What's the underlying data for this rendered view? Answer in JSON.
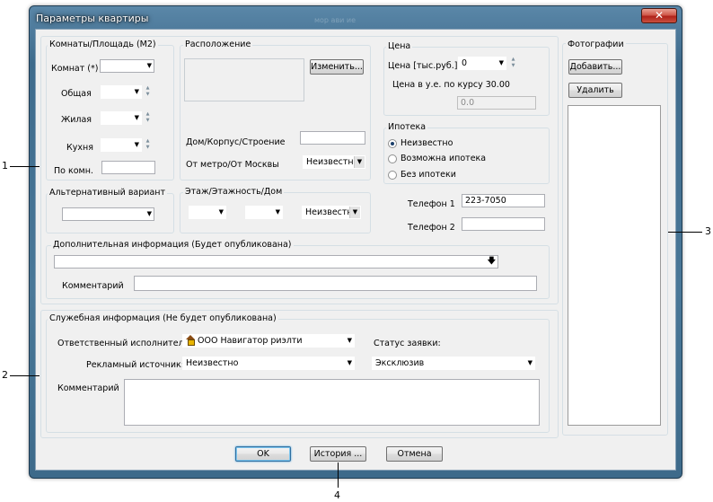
{
  "window": {
    "title": "Параметры квартиры",
    "ghost_title": "мор ави ие",
    "close_glyph": "✕"
  },
  "rooms": {
    "title": "Комнаты/Площадь (М2)",
    "rooms_label": "Комнат (*)",
    "rooms_value": "",
    "total_label": "Общая",
    "living_label": "Жилая",
    "kitchen_label": "Кухня",
    "per_room_label": "По комн."
  },
  "alt": {
    "title": "Альтернативный вариант",
    "value": ""
  },
  "location": {
    "title": "Расположение",
    "change_button": "Изменить...",
    "house_label": "Дом/Корпус/Строение",
    "metro_label": "От метро/От Москвы",
    "metro_value": "Неизвестно"
  },
  "floor": {
    "title": "Этаж/Этажность/Дом",
    "house_type_value": "Неизвестно"
  },
  "price": {
    "title": "Цена",
    "price_label": "Цена [тыс.руб.]",
    "price_value": "0",
    "rate_label": "Цена в у.е. по курсу 30.00",
    "usd_value": "0.0"
  },
  "mortgage": {
    "title": "Ипотека",
    "options": [
      "Неизвестно",
      "Возможна ипотека",
      "Без ипотеки"
    ],
    "selected": 0
  },
  "phones": {
    "phone1_label": "Телефон 1",
    "phone1_value": "223-7050",
    "phone2_label": "Телефон 2",
    "phone2_value": ""
  },
  "extra": {
    "title": "Дополнительная информация (Будет опубликована)",
    "comment_label": "Комментарий"
  },
  "service": {
    "title": "Служебная информация (Не будет опубликована)",
    "responsible_label": "Ответственный исполнитель:",
    "responsible_value": "ООО Навигатор риэлти",
    "status_label": "Статус заявки:",
    "ad_source_label": "Рекламный источник:",
    "ad_source_value": "Неизвестно",
    "status_value": "Эксклюзив",
    "comment_label": "Комментарий"
  },
  "photos": {
    "title": "Фотографии",
    "add_button": "Добавить...",
    "delete_button": "Удалить"
  },
  "buttons": {
    "ok": "OK",
    "history": "История ...",
    "cancel": "Отмена"
  },
  "callouts": [
    "1",
    "2",
    "3",
    "4"
  ]
}
